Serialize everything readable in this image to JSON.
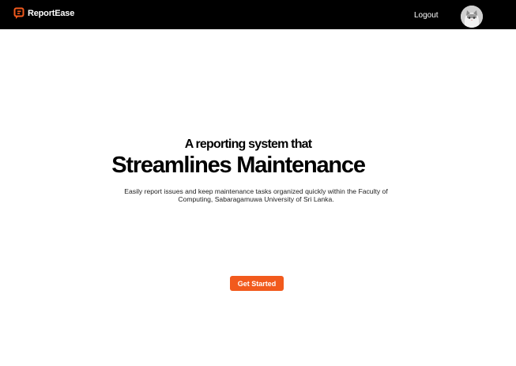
{
  "navbar": {
    "brand_name": "ReportEase",
    "brand_logo_icon": "report-bubble-icon",
    "logout_label": "Logout",
    "avatar_icon": "cat-avatar",
    "background_color": "#000000"
  },
  "hero": {
    "subtitle": "A reporting system that",
    "title": "Streamlines Maintenance",
    "description": "Easily report issues and keep maintenance tasks organized quickly within the Faculty of Computing, Sabaragamuwa University of Sri Lanka.",
    "cta_label": "Get Started"
  },
  "colors": {
    "accent": "#f25a1d",
    "text": "#000000",
    "background": "#ffffff"
  }
}
